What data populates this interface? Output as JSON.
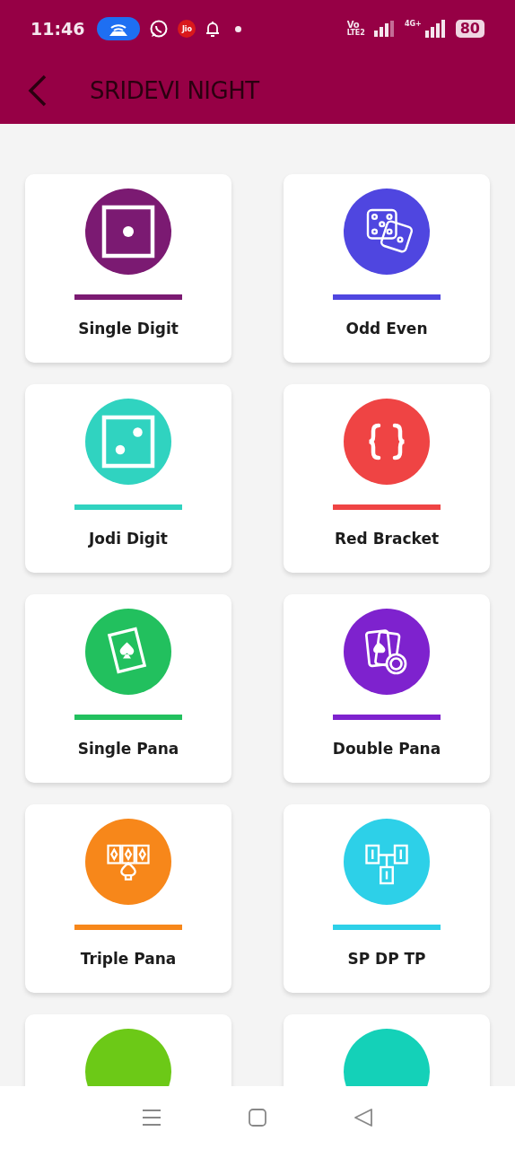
{
  "status_bar": {
    "time": "11:46",
    "carrier_badge": "Jio",
    "volte": "Vo",
    "lte": "LTE2",
    "network": "4G+",
    "battery": "80"
  },
  "header": {
    "title": "SRIDEVI NIGHT"
  },
  "games": [
    {
      "label": "Single Digit",
      "color": "#7b1a72",
      "kind": "die-one"
    },
    {
      "label": "Odd Even",
      "color": "#4f46e0",
      "kind": "dice"
    },
    {
      "label": "Jodi Digit",
      "color": "#30d3c0",
      "kind": "die-two"
    },
    {
      "label": "Red Bracket",
      "color": "#ef4444",
      "kind": "braces"
    },
    {
      "label": "Single Pana",
      "color": "#22c05e",
      "kind": "card"
    },
    {
      "label": "Double Pana",
      "color": "#7e22ce",
      "kind": "chip"
    },
    {
      "label": "Triple Pana",
      "color": "#f7871a",
      "kind": "triple"
    },
    {
      "label": "SP DP TP",
      "color": "#2dd0e8",
      "kind": "tree"
    },
    {
      "color": "#6cc917",
      "kind": "partial"
    },
    {
      "color": "#14d1b8",
      "kind": "partial"
    }
  ]
}
